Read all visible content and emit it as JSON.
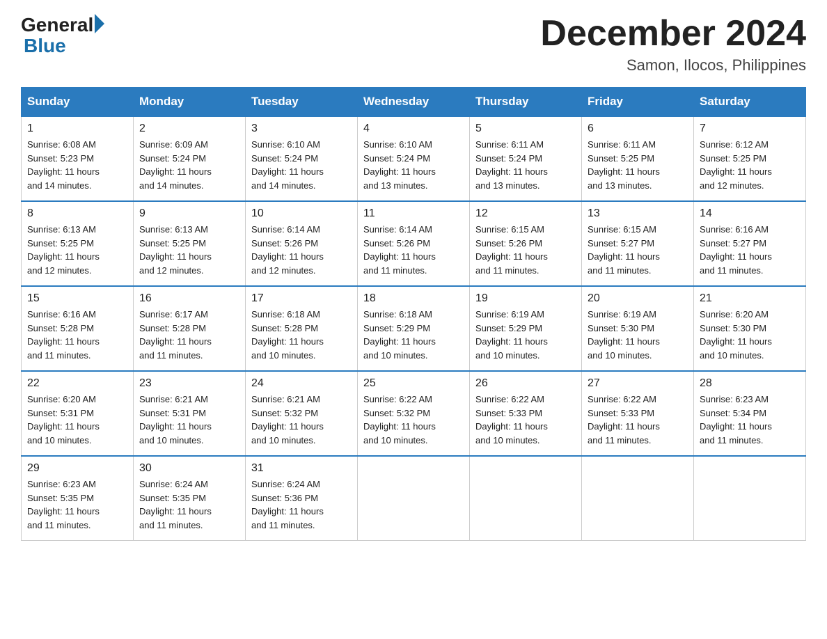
{
  "logo": {
    "general": "General",
    "blue": "Blue"
  },
  "title": "December 2024",
  "location": "Samon, Ilocos, Philippines",
  "days_of_week": [
    "Sunday",
    "Monday",
    "Tuesday",
    "Wednesday",
    "Thursday",
    "Friday",
    "Saturday"
  ],
  "weeks": [
    [
      {
        "day": "1",
        "sunrise": "6:08 AM",
        "sunset": "5:23 PM",
        "daylight": "11 hours and 14 minutes."
      },
      {
        "day": "2",
        "sunrise": "6:09 AM",
        "sunset": "5:24 PM",
        "daylight": "11 hours and 14 minutes."
      },
      {
        "day": "3",
        "sunrise": "6:10 AM",
        "sunset": "5:24 PM",
        "daylight": "11 hours and 14 minutes."
      },
      {
        "day": "4",
        "sunrise": "6:10 AM",
        "sunset": "5:24 PM",
        "daylight": "11 hours and 13 minutes."
      },
      {
        "day": "5",
        "sunrise": "6:11 AM",
        "sunset": "5:24 PM",
        "daylight": "11 hours and 13 minutes."
      },
      {
        "day": "6",
        "sunrise": "6:11 AM",
        "sunset": "5:25 PM",
        "daylight": "11 hours and 13 minutes."
      },
      {
        "day": "7",
        "sunrise": "6:12 AM",
        "sunset": "5:25 PM",
        "daylight": "11 hours and 12 minutes."
      }
    ],
    [
      {
        "day": "8",
        "sunrise": "6:13 AM",
        "sunset": "5:25 PM",
        "daylight": "11 hours and 12 minutes."
      },
      {
        "day": "9",
        "sunrise": "6:13 AM",
        "sunset": "5:25 PM",
        "daylight": "11 hours and 12 minutes."
      },
      {
        "day": "10",
        "sunrise": "6:14 AM",
        "sunset": "5:26 PM",
        "daylight": "11 hours and 12 minutes."
      },
      {
        "day": "11",
        "sunrise": "6:14 AM",
        "sunset": "5:26 PM",
        "daylight": "11 hours and 11 minutes."
      },
      {
        "day": "12",
        "sunrise": "6:15 AM",
        "sunset": "5:26 PM",
        "daylight": "11 hours and 11 minutes."
      },
      {
        "day": "13",
        "sunrise": "6:15 AM",
        "sunset": "5:27 PM",
        "daylight": "11 hours and 11 minutes."
      },
      {
        "day": "14",
        "sunrise": "6:16 AM",
        "sunset": "5:27 PM",
        "daylight": "11 hours and 11 minutes."
      }
    ],
    [
      {
        "day": "15",
        "sunrise": "6:16 AM",
        "sunset": "5:28 PM",
        "daylight": "11 hours and 11 minutes."
      },
      {
        "day": "16",
        "sunrise": "6:17 AM",
        "sunset": "5:28 PM",
        "daylight": "11 hours and 11 minutes."
      },
      {
        "day": "17",
        "sunrise": "6:18 AM",
        "sunset": "5:28 PM",
        "daylight": "11 hours and 10 minutes."
      },
      {
        "day": "18",
        "sunrise": "6:18 AM",
        "sunset": "5:29 PM",
        "daylight": "11 hours and 10 minutes."
      },
      {
        "day": "19",
        "sunrise": "6:19 AM",
        "sunset": "5:29 PM",
        "daylight": "11 hours and 10 minutes."
      },
      {
        "day": "20",
        "sunrise": "6:19 AM",
        "sunset": "5:30 PM",
        "daylight": "11 hours and 10 minutes."
      },
      {
        "day": "21",
        "sunrise": "6:20 AM",
        "sunset": "5:30 PM",
        "daylight": "11 hours and 10 minutes."
      }
    ],
    [
      {
        "day": "22",
        "sunrise": "6:20 AM",
        "sunset": "5:31 PM",
        "daylight": "11 hours and 10 minutes."
      },
      {
        "day": "23",
        "sunrise": "6:21 AM",
        "sunset": "5:31 PM",
        "daylight": "11 hours and 10 minutes."
      },
      {
        "day": "24",
        "sunrise": "6:21 AM",
        "sunset": "5:32 PM",
        "daylight": "11 hours and 10 minutes."
      },
      {
        "day": "25",
        "sunrise": "6:22 AM",
        "sunset": "5:32 PM",
        "daylight": "11 hours and 10 minutes."
      },
      {
        "day": "26",
        "sunrise": "6:22 AM",
        "sunset": "5:33 PM",
        "daylight": "11 hours and 10 minutes."
      },
      {
        "day": "27",
        "sunrise": "6:22 AM",
        "sunset": "5:33 PM",
        "daylight": "11 hours and 11 minutes."
      },
      {
        "day": "28",
        "sunrise": "6:23 AM",
        "sunset": "5:34 PM",
        "daylight": "11 hours and 11 minutes."
      }
    ],
    [
      {
        "day": "29",
        "sunrise": "6:23 AM",
        "sunset": "5:35 PM",
        "daylight": "11 hours and 11 minutes."
      },
      {
        "day": "30",
        "sunrise": "6:24 AM",
        "sunset": "5:35 PM",
        "daylight": "11 hours and 11 minutes."
      },
      {
        "day": "31",
        "sunrise": "6:24 AM",
        "sunset": "5:36 PM",
        "daylight": "11 hours and 11 minutes."
      },
      null,
      null,
      null,
      null
    ]
  ],
  "labels": {
    "sunrise": "Sunrise:",
    "sunset": "Sunset:",
    "daylight": "Daylight:"
  },
  "colors": {
    "header_bg": "#2b7bbf",
    "header_text": "#ffffff",
    "border": "#2b7bbf",
    "cell_border": "#cccccc"
  }
}
